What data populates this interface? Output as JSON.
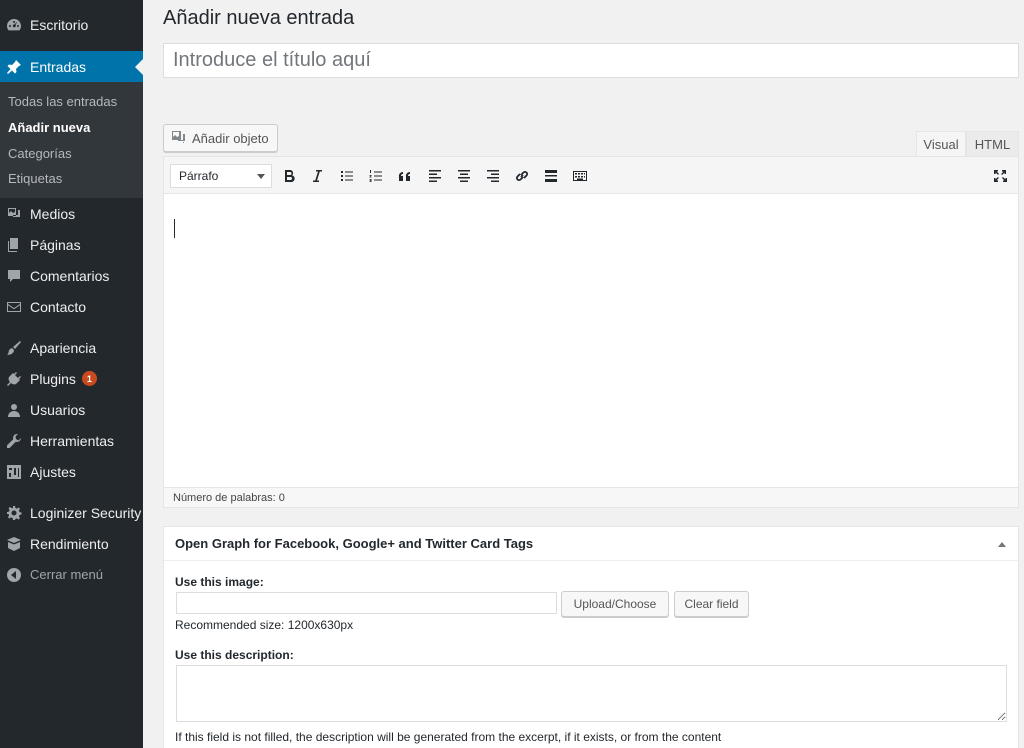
{
  "sidebar": {
    "items": [
      {
        "label": "Escritorio",
        "icon": "dashboard-icon"
      },
      {
        "label": "Entradas",
        "icon": "pin-icon"
      },
      {
        "label": "Medios",
        "icon": "media-icon"
      },
      {
        "label": "Páginas",
        "icon": "pages-icon"
      },
      {
        "label": "Comentarios",
        "icon": "comments-icon"
      },
      {
        "label": "Contacto",
        "icon": "mail-icon"
      },
      {
        "label": "Apariencia",
        "icon": "brush-icon"
      },
      {
        "label": "Plugins",
        "icon": "plugin-icon",
        "badge": "1"
      },
      {
        "label": "Usuarios",
        "icon": "users-icon"
      },
      {
        "label": "Herramientas",
        "icon": "wrench-icon"
      },
      {
        "label": "Ajustes",
        "icon": "settings-icon"
      },
      {
        "label": "Loginizer Security",
        "icon": "gear-icon"
      },
      {
        "label": "Rendimiento",
        "icon": "performance-icon"
      }
    ],
    "submenu": [
      "Todas las entradas",
      "Añadir nueva",
      "Categorías",
      "Etiquetas"
    ],
    "collapse_label": "Cerrar menú"
  },
  "page": {
    "title": "Añadir nueva entrada",
    "title_placeholder": "Introduce el título aquí"
  },
  "editor": {
    "add_media_label": "Añadir objeto",
    "tab_visual": "Visual",
    "tab_html": "HTML",
    "format_select": "Párrafo",
    "word_count": "Número de palabras: 0"
  },
  "og_box": {
    "title": "Open Graph for Facebook, Google+ and Twitter Card Tags",
    "image_label": "Use this image:",
    "upload_button": "Upload/Choose",
    "clear_button": "Clear field",
    "recommended_size": "Recommended size: 1200x630px",
    "description_label": "Use this description:",
    "description_help": "If this field is not filled, the description will be generated from the excerpt, if it exists, or from the content"
  },
  "colors": {
    "sidebar_bg": "#23282d",
    "submenu_bg": "#32373c",
    "accent": "#0073aa",
    "badge": "#ca4a1f"
  }
}
